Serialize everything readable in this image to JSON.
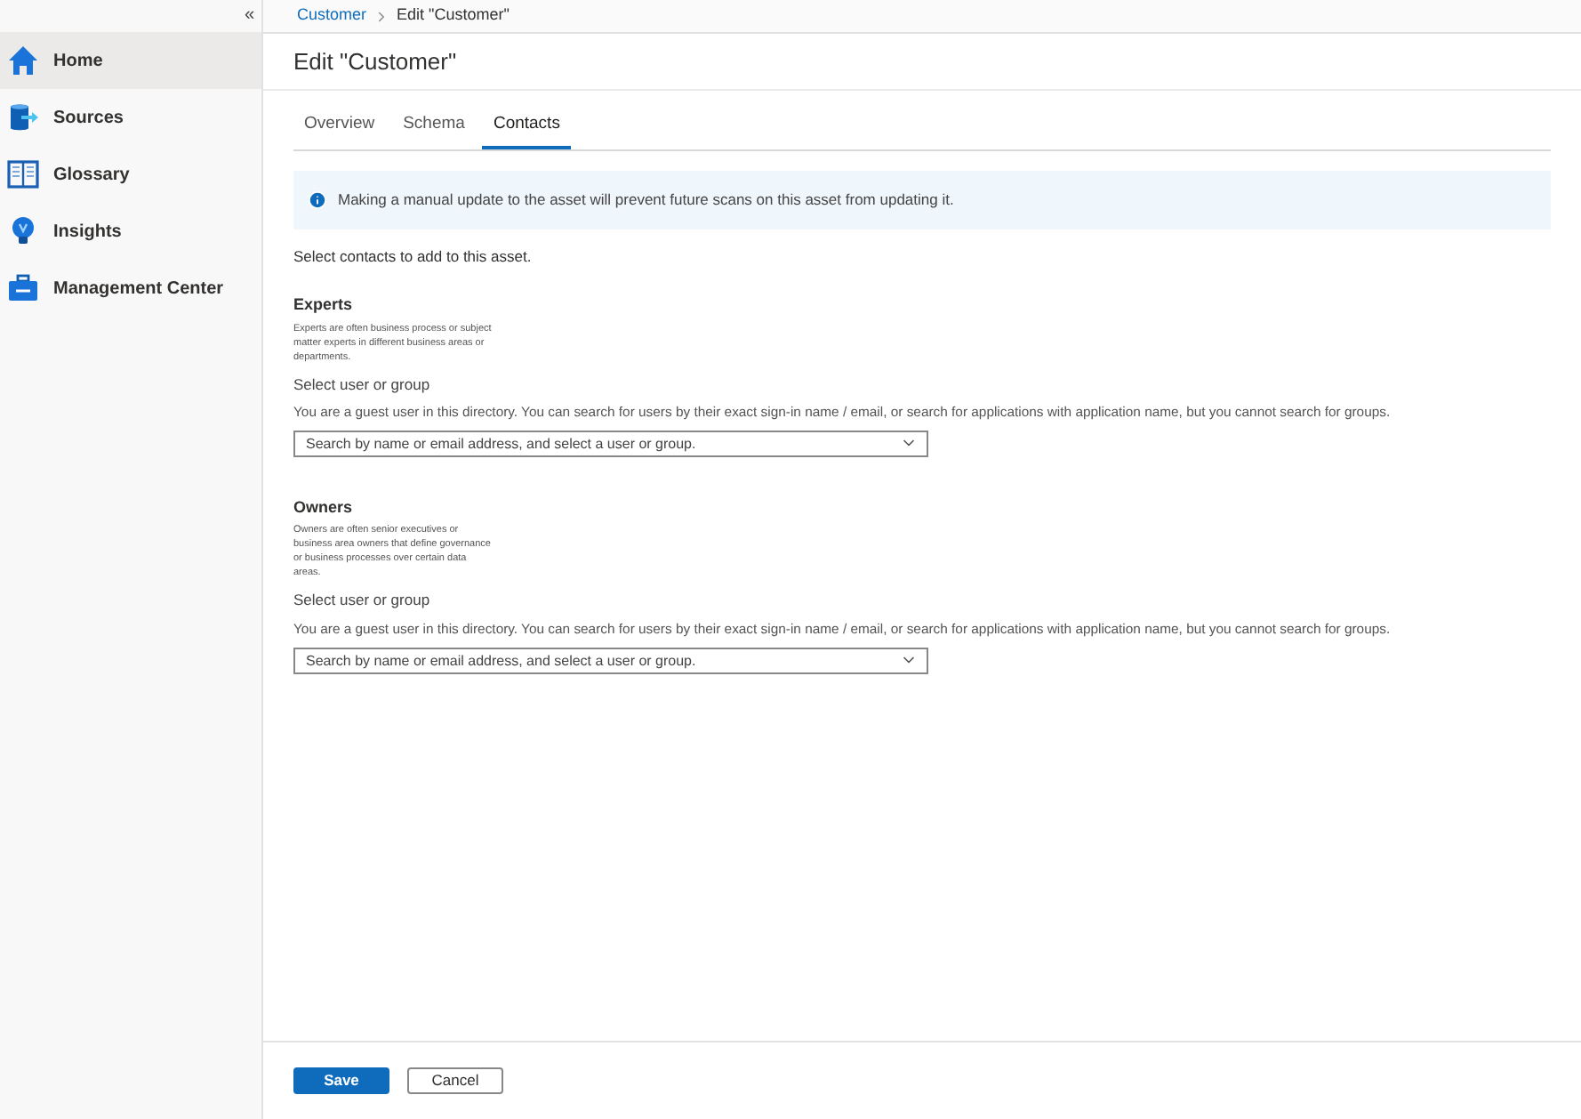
{
  "sidebar": {
    "collapse": "«",
    "items": [
      {
        "label": "Home",
        "selected": true
      },
      {
        "label": "Sources",
        "selected": false
      },
      {
        "label": "Glossary",
        "selected": false
      },
      {
        "label": "Insights",
        "selected": false
      },
      {
        "label": "Management Center",
        "selected": false
      }
    ]
  },
  "breadcrumb": [
    "Customer",
    "Edit \"Customer\""
  ],
  "title": "Edit \"Customer\"",
  "tabs": [
    {
      "label": "Overview",
      "selected": false
    },
    {
      "label": "Schema",
      "selected": false
    },
    {
      "label": "Contacts",
      "selected": true
    }
  ],
  "info": "Making a manual update to the asset will prevent future scans on this asset from updating it.",
  "intro": "Select contacts to add to this asset.",
  "sections": [
    {
      "heading": "Experts",
      "description": "Experts are often business process or subject matter experts in different business areas or departments.",
      "label": "Select user or group",
      "note": "You are a guest user in this directory. You can search for users by their exact sign-in name / email, or search for applications with application name, but you cannot search for groups.",
      "placeholder": "Search by name or email address, and select a user or group."
    },
    {
      "heading": "Owners",
      "description": "Owners are often senior executives or business area owners that define governance or business processes over certain data areas.",
      "label": "Select user or group",
      "note": "You are a guest user in this directory. You can search for users by their exact sign-in name / email, or search for applications with application name, but you cannot search for groups.",
      "placeholder": "Search by name or email address, and select a user or group."
    }
  ],
  "buttons": [
    {
      "label": "Save",
      "kind": "primary"
    },
    {
      "label": "Cancel",
      "kind": "secondary"
    }
  ]
}
